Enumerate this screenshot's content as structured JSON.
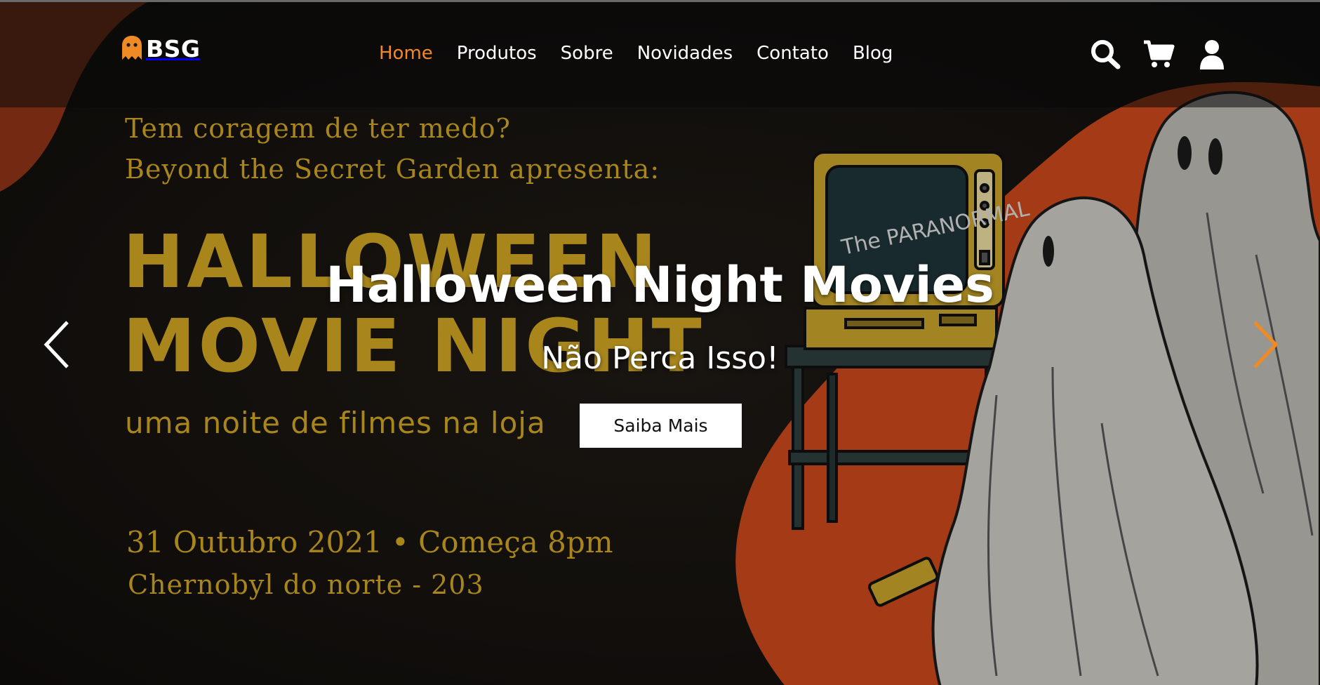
{
  "brand": {
    "name": "BSG",
    "logo_icon": "ghost-icon",
    "accent_color": "#f08a24"
  },
  "nav": {
    "items": [
      {
        "label": "Home",
        "active": true
      },
      {
        "label": "Produtos",
        "active": false
      },
      {
        "label": "Sobre",
        "active": false
      },
      {
        "label": "Novidades",
        "active": false
      },
      {
        "label": "Contato",
        "active": false
      },
      {
        "label": "Blog",
        "active": false
      }
    ],
    "icons": [
      "search-icon",
      "cart-icon",
      "user-icon"
    ]
  },
  "poster": {
    "tagline": "Tem coragem de ter medo?",
    "presents": "Beyond the Secret Garden apresenta:",
    "title_line1": "HALLOWEEN",
    "title_line2": "MOVIE NIGHT",
    "subline": "uma noite de filmes na loja",
    "date": "31 Outubro 2021 • Começa 8pm",
    "place": "Chernobyl do norte - 203",
    "tv_screen": "The PARANORMAL"
  },
  "carousel": {
    "title": "Halloween Night Movies",
    "subtitle": "Não Perca Isso!",
    "cta_label": "Saiba Mais",
    "prev_icon": "chevron-left-icon",
    "next_icon": "chevron-right-icon"
  },
  "colors": {
    "background": "#161311",
    "orange_blob": "#c8471c",
    "poster_gold": "#a8861c",
    "ghost": "#c9c7c1"
  }
}
